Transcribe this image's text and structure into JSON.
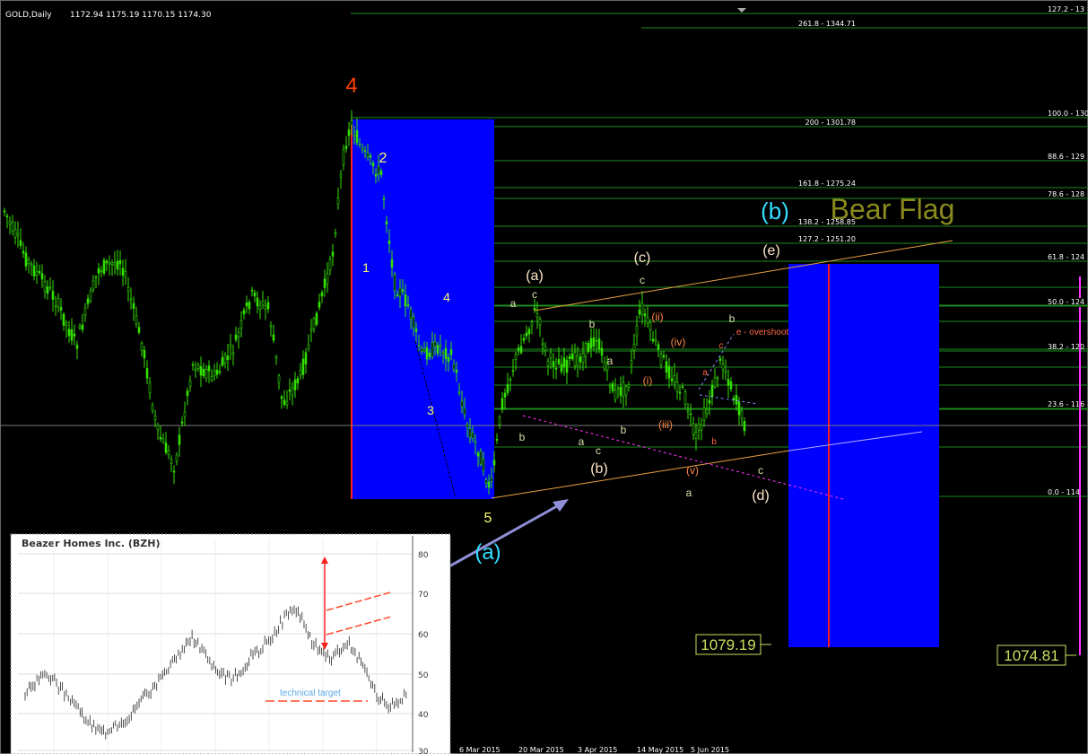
{
  "header": {
    "symbol": "GOLD,Daily",
    "ohlc": "1172.94 1175.19 1170.15 1174.30"
  },
  "colors": {
    "background": "#000000",
    "candle": "#33e000",
    "zone": "#0000ff",
    "fib_line": "#1e8a1e",
    "trendline": "#e8a040",
    "target": "#ff2020"
  },
  "fib_levels": [
    {
      "label": "261.8 - 1344.71"
    },
    {
      "label": "200 - 1301.78"
    },
    {
      "label": "161.8 - 1275.24"
    },
    {
      "label": "138.2 - 1258.85"
    },
    {
      "label": "127.2 - 1251.20"
    },
    {
      "label": "100.0 - 1232.31"
    },
    {
      "label": "88.6 - 1224.39"
    },
    {
      "label": "78.6 - 1217.44"
    },
    {
      "label": "61.8 - 1205.77"
    },
    {
      "label": "50.0 - 1197.58"
    },
    {
      "label": "38.2 - 1189.38"
    },
    {
      "label": "23.6 - 1179.24"
    },
    {
      "label": "0.0 - 1162.84"
    }
  ],
  "right_levels": [
    {
      "label": "127.2 - 13"
    },
    {
      "label": "100.0 - 130"
    },
    {
      "label": "88.6 - 129"
    },
    {
      "label": "78.6 - 128"
    },
    {
      "label": "61.8 - 124"
    },
    {
      "label": "50.0 - 124"
    },
    {
      "label": "38.2 - 120"
    },
    {
      "label": "23.6 - 116"
    },
    {
      "label": "0.0 - 114"
    }
  ],
  "wave_labels": [
    {
      "text": "4",
      "color": "#ff4000"
    },
    {
      "text": "2",
      "color": "#ffff66"
    },
    {
      "text": "1",
      "color": "#ffff66"
    },
    {
      "text": "4",
      "color": "#ffff66"
    },
    {
      "text": "3",
      "color": "#ffff66"
    },
    {
      "text": "5",
      "color": "#ffff66"
    },
    {
      "text": "(a)",
      "color": "#33ddff"
    },
    {
      "text": "(b)",
      "color": "#33ddff"
    },
    {
      "text": "Bear Flag",
      "color": "#8a8a1e"
    },
    {
      "text": "(a)",
      "color": "#ffe6c8"
    },
    {
      "text": "(b)",
      "color": "#ffe6c8"
    },
    {
      "text": "(c)",
      "color": "#ffe6c8"
    },
    {
      "text": "(d)",
      "color": "#ffe6c8"
    },
    {
      "text": "(e)",
      "color": "#ffe6c8"
    },
    {
      "text": "a",
      "color": "#d8e0a8"
    },
    {
      "text": "c",
      "color": "#d8e0a8"
    },
    {
      "text": "b",
      "color": "#d8e0a8"
    },
    {
      "text": "a",
      "color": "#d8e0a8"
    },
    {
      "text": "c",
      "color": "#d8e0a8"
    },
    {
      "text": "b",
      "color": "#d8e0a8"
    },
    {
      "text": "b",
      "color": "#d8e0a8"
    },
    {
      "text": "c",
      "color": "#d8e0a8"
    },
    {
      "text": "b",
      "color": "#d8e0a8"
    },
    {
      "text": "a",
      "color": "#d8e0a8"
    },
    {
      "text": "b",
      "color": "#d8e0a8"
    },
    {
      "text": "c",
      "color": "#d8e0a8"
    },
    {
      "text": "a",
      "color": "#d8e0a8"
    },
    {
      "text": "(ii)",
      "color": "#ff8844"
    },
    {
      "text": "(iv)",
      "color": "#ff8844"
    },
    {
      "text": "(i)",
      "color": "#ff8844"
    },
    {
      "text": "(iii)",
      "color": "#ff8844"
    },
    {
      "text": "(v)",
      "color": "#ff8844"
    },
    {
      "text": "e - overshoot",
      "color": "#ff6644"
    },
    {
      "text": "a",
      "color": "#ff6644"
    },
    {
      "text": "c",
      "color": "#ff6644"
    },
    {
      "text": "b",
      "color": "#ff6644"
    }
  ],
  "targets": [
    {
      "value": "1079.19"
    },
    {
      "value": "1074.81"
    }
  ],
  "dates": [
    "6 Mar 2015",
    "20 Mar 2015",
    "3 Apr 2015",
    "14 May 2015",
    "5 Jun 2015"
  ],
  "inset": {
    "title": "Beazer Homes Inc. (BZH)",
    "annotation": "technical target",
    "y_ticks": [
      "80",
      "70",
      "60",
      "50",
      "40",
      "30"
    ]
  },
  "chart_data": {
    "type": "candlestick",
    "ylim": [
      1115,
      1355
    ],
    "fib_values": [
      1344.71,
      1301.78,
      1275.24,
      1258.85,
      1251.2,
      1232.31,
      1224.39,
      1217.44,
      1205.77,
      1197.58,
      1189.38,
      1179.24,
      1162.84
    ],
    "targets": [
      1079.19,
      1074.81
    ],
    "last_price": 1174.3,
    "inset_series": {
      "name": "Beazer Homes Inc. (BZH)",
      "ylim": [
        30,
        85
      ],
      "values": [
        50,
        54,
        57,
        55,
        50,
        46,
        42,
        38,
        36,
        39,
        40,
        44,
        48,
        52,
        57,
        61,
        66,
        70,
        66,
        60,
        57,
        55,
        58,
        63,
        66,
        70,
        75,
        80,
        78,
        70,
        65,
        62,
        66,
        68,
        62,
        55,
        49,
        46,
        48,
        50
      ]
    }
  }
}
